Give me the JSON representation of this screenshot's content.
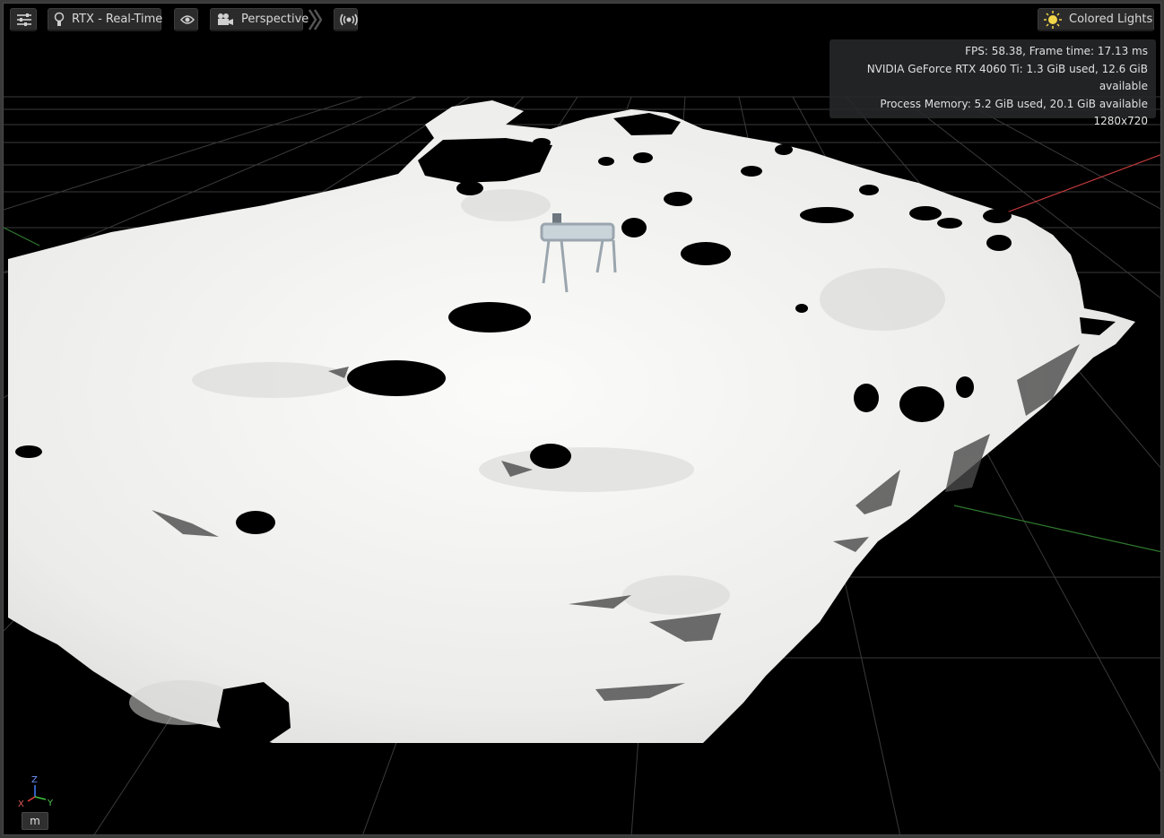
{
  "toolbar": {
    "settings_icon": "sliders-icon",
    "render_mode_label": "RTX - Real-Time",
    "render_mode_icon": "lightbulb-icon",
    "visibility_icon": "eye-icon",
    "camera_label": "Perspective",
    "camera_icon": "camera-icon",
    "expand_icon": "double-chevron-right-icon",
    "broadcast_icon": "broadcast-icon",
    "lighting_label": "Colored Lights",
    "lighting_icon": "sun-icon"
  },
  "stats": {
    "fps_line": "FPS: 58.38, Frame time: 17.13 ms",
    "gpu_line": "NVIDIA GeForce RTX 4060 Ti: 1.3 GiB used, 12.6 GiB available",
    "memory_line": "Process Memory: 5.2 GiB used, 20.1 GiB available",
    "resolution_line": "1280x720"
  },
  "axis_gizmo": {
    "z": "Z",
    "x": "X",
    "y": "Y"
  },
  "units_label": "m",
  "colors": {
    "viewport_bg": "#000000",
    "terrain": "#f4f4f3",
    "grid": "#444444",
    "axis_red": "#e04040",
    "axis_green": "#40c040",
    "axis_blue": "#4080ff",
    "gizmo_sun": "#f2d64a"
  }
}
